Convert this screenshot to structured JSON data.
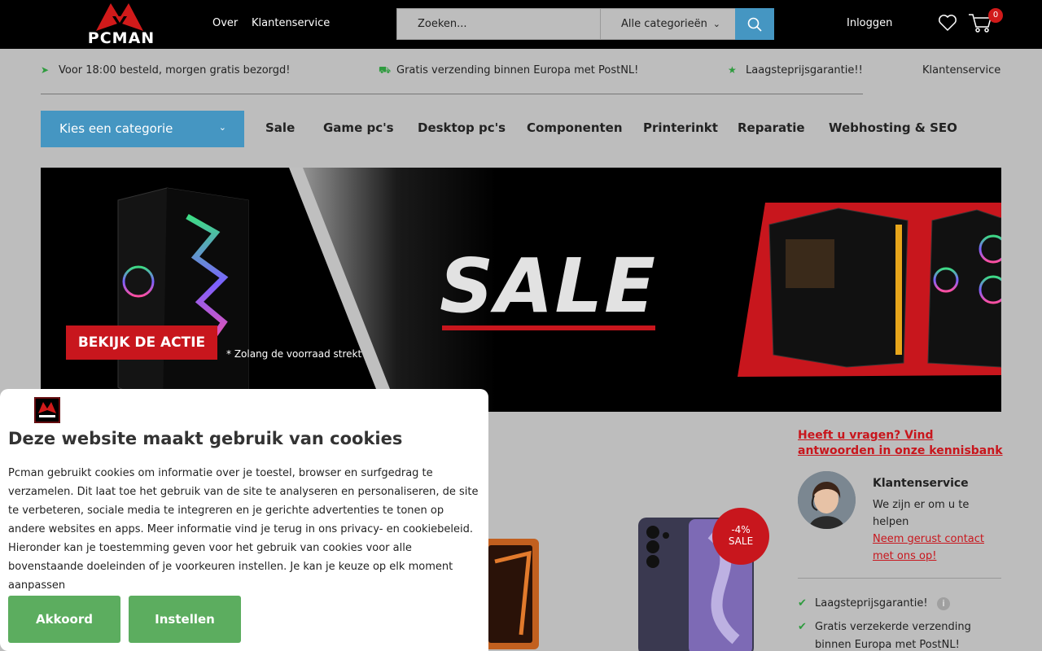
{
  "header": {
    "logo_text": "PCMAN",
    "links": [
      "Over",
      "Klantenservice"
    ],
    "search_placeholder": "Zoeken...",
    "category_select": "Alle categorieën",
    "login": "Inloggen",
    "cart_count": "0"
  },
  "usp": {
    "items": [
      "Voor 18:00 besteld, morgen gratis bezorgd!",
      "Gratis verzending binnen Europa met PostNL!",
      "Laagsteprijsgarantie!!"
    ],
    "service_link": "Klantenservice"
  },
  "nav": {
    "category_button": "Kies een categorie",
    "items": [
      "Sale",
      "Game pc's",
      "Desktop pc's",
      "Componenten",
      "Printerinkt",
      "Reparatie",
      "Webhosting & SEO"
    ]
  },
  "banner": {
    "headline": "SALE",
    "cta": "BEKIJK DE ACTIE",
    "note": "* Zolang de voorraad strekt"
  },
  "sidebar": {
    "faq_link": "Heeft u vragen? Vind antwoorden in onze kennisbank",
    "service_title": "Klantenservice",
    "service_text": "We zijn er om u te helpen",
    "service_link": "Neem gerust contact met ons op!",
    "usps": [
      "Laagsteprijsgarantie!",
      "Gratis verzekerde verzending binnen Europa met PostNL!"
    ]
  },
  "product": {
    "discount": "-4%",
    "badge": "SALE"
  },
  "cookie": {
    "title": "Deze website maakt gebruik van cookies",
    "body": "Pcman gebruikt cookies om informatie over je toestel, browser en surfgedrag te verzamelen. Dit laat toe het gebruik van de site te analyseren en personaliseren, de site te verbeteren, sociale media te integreren en je gerichte advertenties te tonen op andere websites en apps. Meer informatie vind je terug in ons privacy- en cookiebeleid. Hieronder kan je toestemming geven voor het gebruik van cookies voor alle bovenstaande doeleinden of je voorkeuren instellen. Je kan je keuze op elk moment aanpassen",
    "accept": "Akkoord",
    "settings": "Instellen"
  },
  "colors": {
    "accent_blue": "#4596c2",
    "brand_red": "#c8161d",
    "cookie_green": "#5cad5f",
    "usp_green": "#2e9b3e"
  }
}
